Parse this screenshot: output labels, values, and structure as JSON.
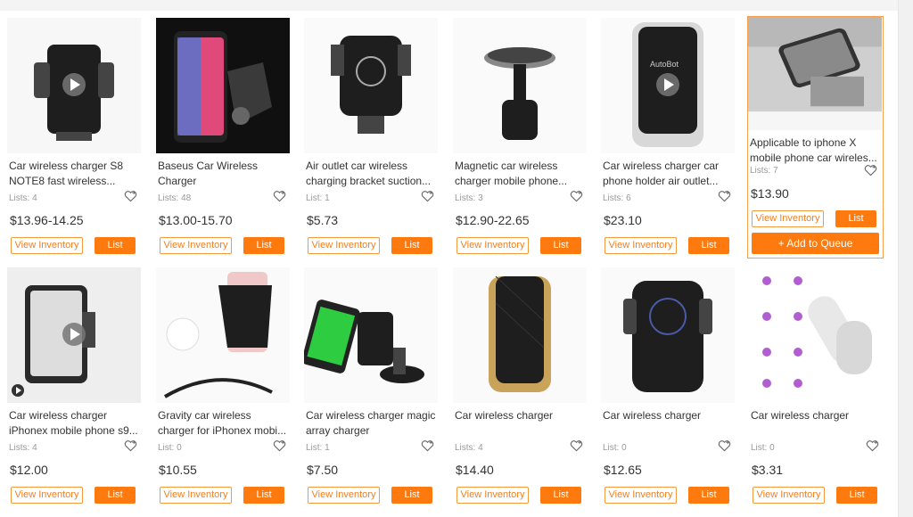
{
  "buttons": {
    "view_inventory": "View Inventory",
    "list": "List",
    "add_to_queue": "+ Add to Queue"
  },
  "products": [
    {
      "title": "Car wireless charger S8 NOTE8 fast wireless...",
      "lists": "Lists: 4",
      "price": "$13.96-14.25",
      "icon": "video-play-icon"
    },
    {
      "title": "Baseus Car Wireless Charger",
      "lists": "Lists: 48",
      "price": "$13.00-15.70",
      "icon": "phone-holder-image"
    },
    {
      "title": "Air outlet car wireless charging bracket suction...",
      "lists": "List: 1",
      "price": "$5.73",
      "icon": "phone-holder-image"
    },
    {
      "title": "Magnetic car wireless charger mobile phone...",
      "lists": "Lists: 3",
      "price": "$12.90-22.65",
      "icon": "magnetic-mount-image"
    },
    {
      "title": "Car wireless charger car phone holder air outlet...",
      "lists": "Lists: 6",
      "price": "$23.10",
      "icon": "video-play-icon"
    },
    {
      "title": "Applicable to iphone X mobile phone car wireles...",
      "lists": "Lists: 7",
      "price": "$13.90",
      "icon": "phone-holder-image",
      "selected": true
    },
    {
      "title": "Car wireless charger iPhonex mobile phone s9...",
      "lists": "Lists: 4",
      "price": "$12.00",
      "icon": "video-play-icon"
    },
    {
      "title": "Gravity car wireless charger for iPhonex mobi...",
      "lists": "List: 0",
      "price": "$10.55",
      "icon": "phone-holder-image"
    },
    {
      "title": "Car wireless charger magic array charger",
      "lists": "List: 1",
      "price": "$7.50",
      "icon": "phone-holder-image"
    },
    {
      "title": "Car wireless charger",
      "lists": "Lists: 4",
      "price": "$14.40",
      "icon": "phone-holder-image"
    },
    {
      "title": "Car wireless charger",
      "lists": "List: 0",
      "price": "$12.65",
      "icon": "phone-holder-image"
    },
    {
      "title": "Car wireless charger",
      "lists": "List: 0",
      "price": "$3.31",
      "icon": "feature-icons-image"
    }
  ]
}
